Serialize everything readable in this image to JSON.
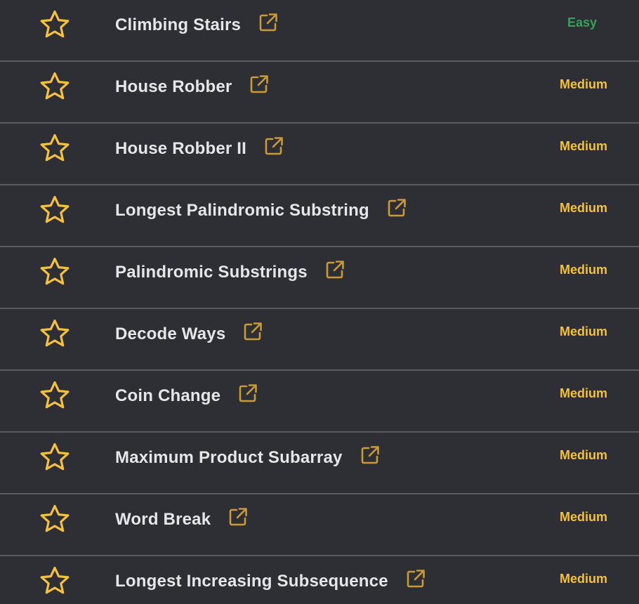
{
  "colors": {
    "background": "#2e2f35",
    "divider": "#5a5b61",
    "star": "#f4c13d",
    "link_icon": "#c99a35",
    "title": "#e6e6e8",
    "easy": "#36a15a",
    "medium": "#f4c13d"
  },
  "problems": [
    {
      "title": "Climbing Stairs",
      "difficulty": "Easy",
      "star_icon": "star-outline-icon",
      "link_icon": "external-link-icon"
    },
    {
      "title": "House Robber",
      "difficulty": "Medium",
      "star_icon": "star-outline-icon",
      "link_icon": "external-link-icon"
    },
    {
      "title": "House Robber II",
      "difficulty": "Medium",
      "star_icon": "star-outline-icon",
      "link_icon": "external-link-icon"
    },
    {
      "title": "Longest Palindromic Substring",
      "difficulty": "Medium",
      "star_icon": "star-outline-icon",
      "link_icon": "external-link-icon"
    },
    {
      "title": "Palindromic Substrings",
      "difficulty": "Medium",
      "star_icon": "star-outline-icon",
      "link_icon": "external-link-icon"
    },
    {
      "title": "Decode Ways",
      "difficulty": "Medium",
      "star_icon": "star-outline-icon",
      "link_icon": "external-link-icon"
    },
    {
      "title": "Coin Change",
      "difficulty": "Medium",
      "star_icon": "star-outline-icon",
      "link_icon": "external-link-icon"
    },
    {
      "title": "Maximum Product Subarray",
      "difficulty": "Medium",
      "star_icon": "star-outline-icon",
      "link_icon": "external-link-icon"
    },
    {
      "title": "Word Break",
      "difficulty": "Medium",
      "star_icon": "star-outline-icon",
      "link_icon": "external-link-icon"
    },
    {
      "title": "Longest Increasing Subsequence",
      "difficulty": "Medium",
      "star_icon": "star-outline-icon",
      "link_icon": "external-link-icon"
    }
  ]
}
